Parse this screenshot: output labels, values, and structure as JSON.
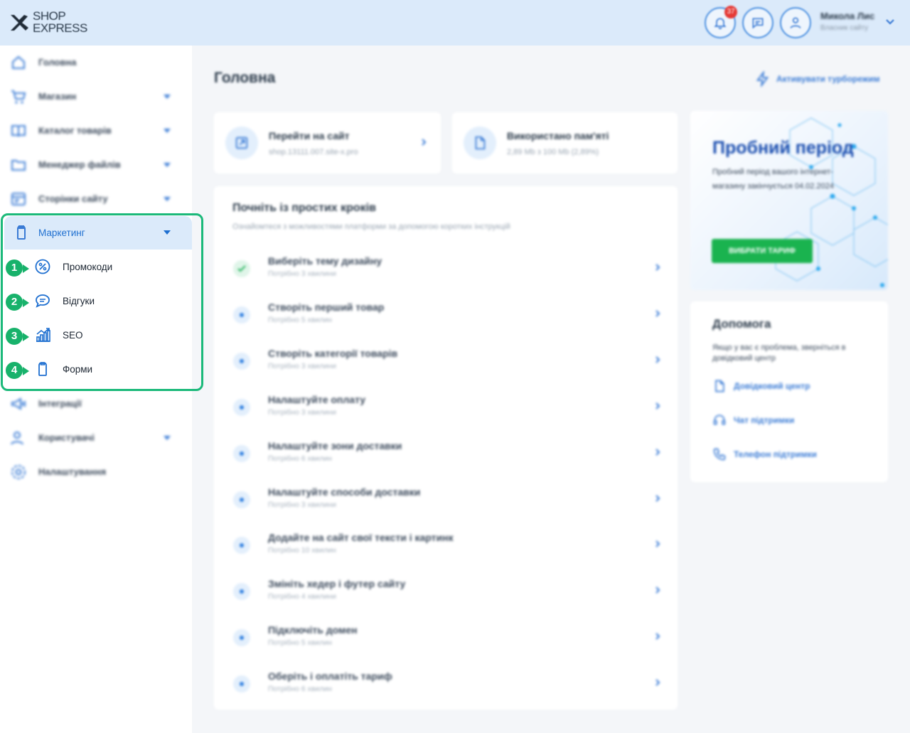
{
  "header": {
    "logo_line1": "SHOP",
    "logo_line2": "EXPRESS",
    "notifications_count": "37",
    "user_name": "Микола Лис",
    "user_role": "Власник сайту"
  },
  "sidebar": {
    "items": [
      {
        "label": "Головна"
      },
      {
        "label": "Магазин"
      },
      {
        "label": "Каталог товарів"
      },
      {
        "label": "Менеджер файлів"
      },
      {
        "label": "Сторінки сайту"
      },
      {
        "label": "Маркетинг"
      },
      {
        "label": "Інтеграції"
      },
      {
        "label": "Користувачі"
      },
      {
        "label": "Налаштування"
      }
    ],
    "marketing_sub": [
      {
        "num": "1",
        "label": "Промокоди"
      },
      {
        "num": "2",
        "label": "Відгуки"
      },
      {
        "num": "3",
        "label": "SEO"
      },
      {
        "num": "4",
        "label": "Форми"
      }
    ]
  },
  "main": {
    "title": "Головна",
    "turbo_label": "Активувати турборежим",
    "site_card": {
      "title": "Перейти на сайт",
      "sub": "shop.13111.007.site-x.pro"
    },
    "memory_card": {
      "title": "Використано пам'яті",
      "sub": "2,89 Mb з 100 Mb (2,89%)"
    },
    "steps": {
      "title": "Почніть із простих кроків",
      "subtitle": "Ознайомтеся з можливостями платформи за допомогою коротких інструкцій",
      "items": [
        {
          "title": "Виберіть тему дизайну",
          "sub": "Потрібно 3 хвилини"
        },
        {
          "title": "Створіть перший товар",
          "sub": "Потрібно 5 хвилин"
        },
        {
          "title": "Створіть категорії товарів",
          "sub": "Потрібно 3 хвилини"
        },
        {
          "title": "Налаштуйте оплату",
          "sub": "Потрібно 3 хвилини"
        },
        {
          "title": "Налаштуйте зони доставки",
          "sub": "Потрібно 6 хвилин"
        },
        {
          "title": "Налаштуйте способи доставки",
          "sub": "Потрібно 3 хвилини"
        },
        {
          "title": "Додайте на сайт свої тексти і картинк",
          "sub": "Потрібно 10 хвилин"
        },
        {
          "title": "Змініть хедер і футер сайту",
          "sub": "Потрібно 4 хвилини"
        },
        {
          "title": "Підключіть домен",
          "sub": "Потрібно 5 хвилин"
        },
        {
          "title": "Оберіть і оплатіть тариф",
          "sub": "Потрібно 6 хвилин"
        }
      ]
    },
    "trial": {
      "title": "Пробний період",
      "text": "Пробний період вашого інтернет-магазину закінчується 04.02.2024",
      "button": "ВИБРАТИ ТАРИФ"
    },
    "help": {
      "title": "Допомога",
      "text": "Якщо у вас є проблема, зверніться в довідковий центр",
      "links": [
        {
          "label": "Довідковий центр"
        },
        {
          "label": "Чат підтримки"
        },
        {
          "label": "Телефон підтримки"
        }
      ]
    }
  },
  "colors": {
    "accent": "#3a7bd5",
    "header_bg": "#dbeafa",
    "highlight": "#1bb97a",
    "trial_button": "#1ab34f",
    "badge": "#e53935"
  }
}
